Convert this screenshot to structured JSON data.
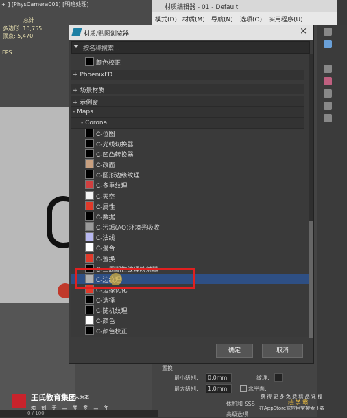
{
  "viewport": {
    "label": "+ ] [PhysCamera001] [明暗处理]",
    "stats": [
      {
        "label": "总计",
        "value": ""
      },
      {
        "label": "多边形:",
        "value": "10,755"
      },
      {
        "label": "顶点:",
        "value": "5,470"
      }
    ],
    "fps": "FPS:"
  },
  "material_editor": {
    "title": "材质编辑器 - 01 - Default",
    "menu": [
      "模式(D)",
      "材质(M)",
      "导航(N)",
      "选项(O)",
      "实用程序(U)"
    ]
  },
  "dialog": {
    "title": "材质/贴图浏览器",
    "search_placeholder": "按名称搜索...",
    "close": "×",
    "rows": [
      {
        "label": "颜色校正",
        "swatch": "#000000",
        "type": "item"
      },
      {
        "label": "+ PhoenixFD",
        "type": "header"
      },
      {
        "label": "+ 场景材质",
        "type": "header"
      },
      {
        "label": "+ 示例窗",
        "type": "header"
      },
      {
        "label": "- Maps",
        "type": "header"
      },
      {
        "label": "- Corona",
        "type": "header"
      },
      {
        "label": "C-位图",
        "swatch": "#000000",
        "type": "item"
      },
      {
        "label": "C-光线切换器",
        "swatch": "#000000",
        "type": "item"
      },
      {
        "label": "C-凹凸转换器",
        "swatch": "#000000",
        "type": "item"
      },
      {
        "label": "C-改面",
        "swatch": "#c8a080",
        "type": "item"
      },
      {
        "label": "C-圆形边缘纹理",
        "swatch": "#000000",
        "type": "item"
      },
      {
        "label": "C-多重纹理",
        "swatch": "#d04040",
        "type": "item"
      },
      {
        "label": "C-天空",
        "swatch": "#f4f4f4",
        "type": "item"
      },
      {
        "label": "C-属性",
        "swatch": "#e03a2a",
        "type": "item"
      },
      {
        "label": "C-数据",
        "swatch": "#000000",
        "type": "item"
      },
      {
        "label": "C-污垢(AO)环境光吸收",
        "swatch": "#9a9a9a",
        "type": "item"
      },
      {
        "label": "C-法线",
        "swatch": "#b8b8f0",
        "type": "item"
      },
      {
        "label": "C-混合",
        "swatch": "#ffffff",
        "type": "item"
      },
      {
        "label": "C-置换",
        "swatch": "#e03a2a",
        "type": "item"
      },
      {
        "label": "C-三周期性纹理映射器",
        "swatch": "#000000",
        "type": "item"
      },
      {
        "label": "C-边纹理",
        "swatch": "#b0b0b0",
        "type": "item",
        "selected": true
      },
      {
        "label": "C-边缘优化",
        "swatch": "#e03a2a",
        "type": "item"
      },
      {
        "label": "C-选择",
        "swatch": "#000000",
        "type": "item"
      },
      {
        "label": "C-随机纹理",
        "swatch": "#000000",
        "type": "item"
      },
      {
        "label": "C-颜色",
        "swatch": "#ffffff",
        "type": "item"
      },
      {
        "label": "C-颜色校正",
        "swatch": "#000000",
        "type": "item"
      }
    ],
    "ok": "确定",
    "cancel": "取消"
  },
  "displace_panel": {
    "title": "置换",
    "min_level_label": "最小级别:",
    "min_level_value": "0.0mm",
    "max_level_label": "最大级别:",
    "max_level_value": "1.0mm",
    "texture_label": "纹理:",
    "water_label": "水平面:",
    "volume_sss": "体积和 SSS",
    "advanced": "高级选项"
  },
  "watermark": {
    "name": "王氏教育集团",
    "sub": "以人为本",
    "line": "始 创 于 二 零 零 二 年"
  },
  "promo": {
    "line1": "获 得 更 多 免 费 精 品 课 程",
    "line2": "在AppStore或应用宝搜索下载",
    "brand": "绘 学 霸"
  },
  "timeline": "0 / 100"
}
